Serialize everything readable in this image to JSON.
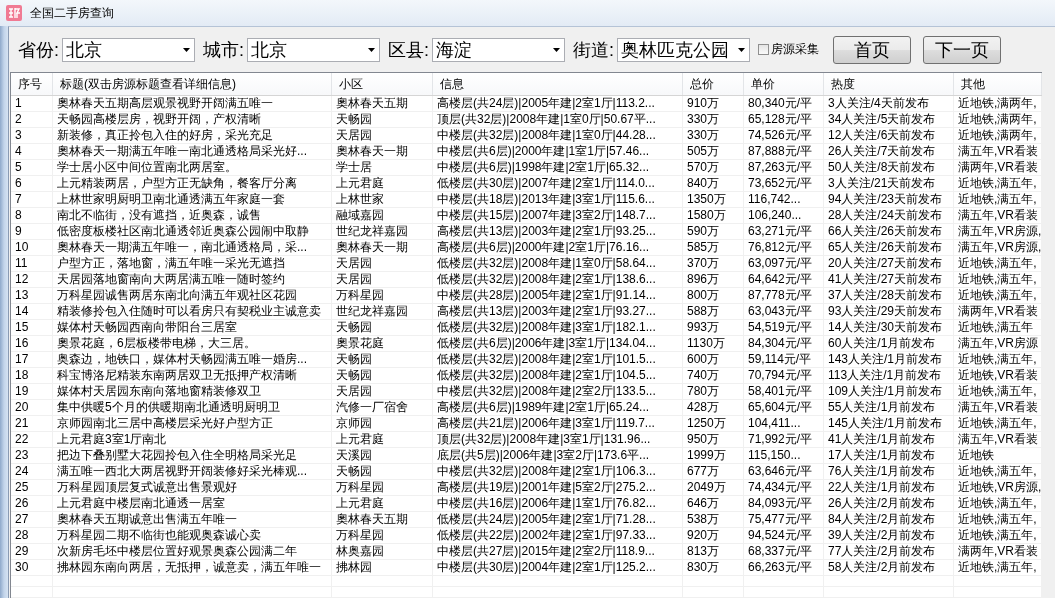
{
  "window": {
    "title": "全国二手房查询"
  },
  "filters": [
    {
      "label": "省份:",
      "value": "北京"
    },
    {
      "label": "城市:",
      "value": "北京"
    },
    {
      "label": "区县:",
      "value": "海淀"
    },
    {
      "label": "街道:",
      "value": "奥林匹克公园"
    }
  ],
  "collect_checkbox": {
    "label": "房源采集",
    "checked": false
  },
  "buttons": [
    "首页",
    "下一页"
  ],
  "table": {
    "columns": [
      "序号",
      "标题(双击房源标题查看详细信息)",
      "小区",
      "信息",
      "总价",
      "单价",
      "热度",
      "其他"
    ],
    "rows": [
      [
        "1",
        "奧林春天五期高层观景视野开阔满五唯一",
        "奧林春天五期",
        "高楼层(共24层)|2005年建|2室1厅|113.2...",
        "910万",
        "80,340元/平",
        "3人关注/4天前发布",
        "近地铁,满两年,"
      ],
      [
        "2",
        "天畅园高楼层房，视野开阔，产权清晰",
        "天畅园",
        "顶层(共32层)|2008年建|1室0厅|50.67平...",
        "330万",
        "65,128元/平",
        "34人关注/5天前发布",
        "近地铁,满两年,"
      ],
      [
        "3",
        "新装修，真正拎包入住的好房，采光充足",
        "天居园",
        "中楼层(共32层)|2008年建|1室0厅|44.28...",
        "330万",
        "74,526元/平",
        "12人关注/6天前发布",
        "近地铁,满两年,"
      ],
      [
        "4",
        "奧林春天一期满五年唯一南北通透格局采光好...",
        "奧林春天一期",
        "中楼层(共6层)|2000年建|1室1厅|57.46...",
        "505万",
        "87,888元/平",
        "26人关注/7天前发布",
        "满五年,VR看装"
      ],
      [
        "5",
        "学士居小区中间位置南北两居室。",
        "学士居",
        "中楼层(共6层)|1998年建|2室1厅|65.32...",
        "570万",
        "87,263元/平",
        "50人关注/8天前发布",
        "满两年,VR看装"
      ],
      [
        "6",
        "上元精装两居，户型方正无缺角，餐客厅分离",
        "上元君庭",
        "低楼层(共30层)|2007年建|2室1厅|114.0...",
        "840万",
        "73,652元/平",
        "3人关注/21天前发布",
        "近地铁,满五年,"
      ],
      [
        "7",
        "上林世家明厨明卫南北通透满五年家庭一套",
        "上林世家",
        "中楼层(共18层)|2013年建|3室1厅|115.6...",
        "1350万",
        "116,742...",
        "94人关注/23天前发布",
        "近地铁,满五年,"
      ],
      [
        "8",
        "南北不临街，没有遮挡，近奥森，诚售",
        "融域嘉园",
        "中楼层(共15层)|2007年建|3室2厅|148.7...",
        "1580万",
        "106,240...",
        "28人关注/24天前发布",
        "满五年,VR看装"
      ],
      [
        "9",
        "低密度板楼社区南北通透邻近奥森公园闹中取静",
        "世纪龙祥嘉园",
        "高楼层(共13层)|2003年建|2室1厅|93.25...",
        "590万",
        "63,271元/平",
        "66人关注/26天前发布",
        "满五年,VR房源,"
      ],
      [
        "10",
        "奧林春天一期满五年唯一，南北通透格局，采...",
        "奧林春天一期",
        "高楼层(共6层)|2000年建|2室1厅|76.16...",
        "585万",
        "76,812元/平",
        "65人关注/26天前发布",
        "满五年,VR房源,"
      ],
      [
        "11",
        "户型方正，落地窗，满五年唯一采光无遮挡",
        "天居园",
        "低楼层(共32层)|2008年建|1室0厅|58.64...",
        "370万",
        "63,097元/平",
        "20人关注/27天前发布",
        "近地铁,满五年,"
      ],
      [
        "12",
        "天居园落地窗南向大两居满五唯一随时签约",
        "天居园",
        "低楼层(共32层)|2008年建|2室1厅|138.6...",
        "896万",
        "64,642元/平",
        "41人关注/27天前发布",
        "近地铁,满五年,"
      ],
      [
        "13",
        "万科星园诚售两居东南北向满五年观社区花园",
        "万科星园",
        "中楼层(共28层)|2005年建|2室1厅|91.14...",
        "800万",
        "87,778元/平",
        "37人关注/28天前发布",
        "近地铁,满五年,"
      ],
      [
        "14",
        "精装修拎包入住随时可以看房只有契税业主诚意卖",
        "世纪龙祥嘉园",
        "高楼层(共13层)|2003年建|2室1厅|93.27...",
        "588万",
        "63,043元/平",
        "93人关注/29天前发布",
        "满两年,VR看装"
      ],
      [
        "15",
        "媒体村天畅园西南向带阳台三居室",
        "天畅园",
        "低楼层(共32层)|2008年建|3室1厅|182.1...",
        "993万",
        "54,519元/平",
        "14人关注/30天前发布",
        "近地铁,满五年"
      ],
      [
        "16",
        "奧景花庭，6层板楼带电梯，大三居。",
        "奧景花庭",
        "低楼层(共6层)|2006年建|3室1厅|134.04...",
        "1130万",
        "84,304元/平",
        "60人关注/1月前发布",
        "满五年,VR房源"
      ],
      [
        "17",
        "奥森边，地铁口，媒体村天畅园满五唯一婚房...",
        "天畅园",
        "低楼层(共32层)|2008年建|2室1厅|101.5...",
        "600万",
        "59,114元/平",
        "143人关注/1月前发布",
        "近地铁,满五年,"
      ],
      [
        "18",
        "科宝博洛尼精装东南两居双卫无抵押产权清晰",
        "天畅园",
        "低楼层(共32层)|2008年建|2室1厅|104.5...",
        "740万",
        "70,794元/平",
        "113人关注/1月前发布",
        "近地铁,VR看装"
      ],
      [
        "19",
        "媒体村天居园东南向落地窗精装修双卫",
        "天居园",
        "中楼层(共32层)|2008年建|2室2厅|133.5...",
        "780万",
        "58,401元/平",
        "109人关注/1月前发布",
        "近地铁,满五年,"
      ],
      [
        "20",
        "集中供暖5个月的供暖期南北通透明厨明卫",
        "汽修一厂宿舍",
        "高楼层(共6层)|1989年建|2室1厅|65.24...",
        "428万",
        "65,604元/平",
        "55人关注/1月前发布",
        "满五年,VR看装"
      ],
      [
        "21",
        "京师园南北三居中高楼层采光好户型方正",
        "京师园",
        "高楼层(共21层)|2006年建|3室1厅|119.7...",
        "1250万",
        "104,411...",
        "145人关注/1月前发布",
        "近地铁,满五年,"
      ],
      [
        "22",
        "上元君庭3室1厅南北",
        "上元君庭",
        "顶层(共32层)|2008年建|3室1厅|131.96...",
        "950万",
        "71,992元/平",
        "41人关注/1月前发布",
        "满五年,VR看装"
      ],
      [
        "23",
        "把边下叠别墅大花园拎包入住全明格局采光足",
        "天溪园",
        "底层(共5层)|2006年建|3室2厅|173.6平...",
        "1999万",
        "115,150...",
        "17人关注/1月前发布",
        "近地铁"
      ],
      [
        "24",
        "满五唯一西北大两居视野开阔装修好采光棒观...",
        "天畅园",
        "中楼层(共32层)|2008年建|2室1厅|106.3...",
        "677万",
        "63,646元/平",
        "76人关注/1月前发布",
        "近地铁,满五年,"
      ],
      [
        "25",
        "万科星园顶层复式诚意出售景观好",
        "万科星园",
        "高楼层(共19层)|2001年建|5室2厅|275.2...",
        "2049万",
        "74,434元/平",
        "22人关注/1月前发布",
        "近地铁,VR房源,"
      ],
      [
        "26",
        "上元君庭中楼层南北通透一居室",
        "上元君庭",
        "中楼层(共16层)|2006年建|1室1厅|76.82...",
        "646万",
        "84,093元/平",
        "26人关注/2月前发布",
        "近地铁,满五年,"
      ],
      [
        "27",
        "奧林春天五期诚意出售满五年唯一",
        "奧林春天五期",
        "低楼层(共24层)|2005年建|2室1厅|71.28...",
        "538万",
        "75,477元/平",
        "84人关注/2月前发布",
        "近地铁,满五年,"
      ],
      [
        "28",
        "万科星园二期不临街也能观奥森诚心卖",
        "万科星园",
        "低楼层(共22层)|2002年建|2室1厅|97.33...",
        "920万",
        "94,524元/平",
        "39人关注/2月前发布",
        "近地铁,满五年,"
      ],
      [
        "29",
        "次新房毛坯中楼层位置好观景奥森公园满二年",
        "林奥嘉园",
        "中楼层(共27层)|2015年建|2室2厅|118.9...",
        "813万",
        "68,337元/平",
        "77人关注/2月前发布",
        "满两年,VR看装"
      ],
      [
        "30",
        "拂林园东南向两居，无抵押，诚意卖，满五年唯一",
        "拂林园",
        "中楼层(共30层)|2004年建|2室1厅|125.2...",
        "830万",
        "66,263元/平",
        "58人关注/2月前发布",
        "近地铁,满五年,"
      ]
    ]
  }
}
